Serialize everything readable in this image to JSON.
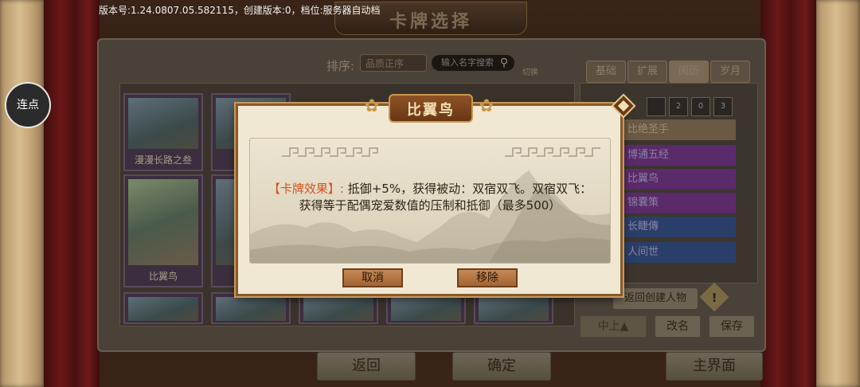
{
  "version_text": "版本号:1.24.0807.05.582115，创建版本:0，档位:服务器自动档",
  "screen_title": "卡牌选择",
  "connect_button": "连点",
  "sort": {
    "label": "排序:",
    "selected": "品质正序",
    "search_placeholder": "输入名字搜索",
    "switch_label": "切换"
  },
  "tabs": [
    "基础",
    "扩展",
    "阅历",
    "岁月"
  ],
  "cards": [
    {
      "caption": "漫漫长路之叁"
    },
    {
      "caption": "比翼鸟"
    }
  ],
  "filter_counts": [
    "",
    "",
    "2",
    "0",
    "3"
  ],
  "right_list": [
    "比绝圣手",
    "博通五经",
    "比翼鸟",
    "锦囊策",
    "长睫傳",
    "人间世"
  ],
  "right_panel": {
    "return_create": "返回创建人物",
    "warn_mark": "!",
    "tier_label": "中上▲",
    "rename": "改名",
    "save": "保存"
  },
  "bottom": {
    "back": "返回",
    "confirm": "确定",
    "main_menu": "主界面"
  },
  "dialog": {
    "title": "比翼鸟",
    "effect_label": "【卡牌效果】:",
    "effect_text": " 抵御+5%，获得被动：双宿双飞。双宿双飞：",
    "effect_text2": "获得等于配偶宠爱数值的压制和抵御（最多500）",
    "cancel": "取消",
    "remove": "移除"
  },
  "colors": {
    "accent_orange": "#d2541e",
    "dialog_bg": "#f1e8d4",
    "dialog_border": "#8a5a2b",
    "title_plate": "#7a4420"
  },
  "icons": [
    "close-icon",
    "search-icon",
    "warning-icon",
    "dragon-ornament-icon"
  ]
}
